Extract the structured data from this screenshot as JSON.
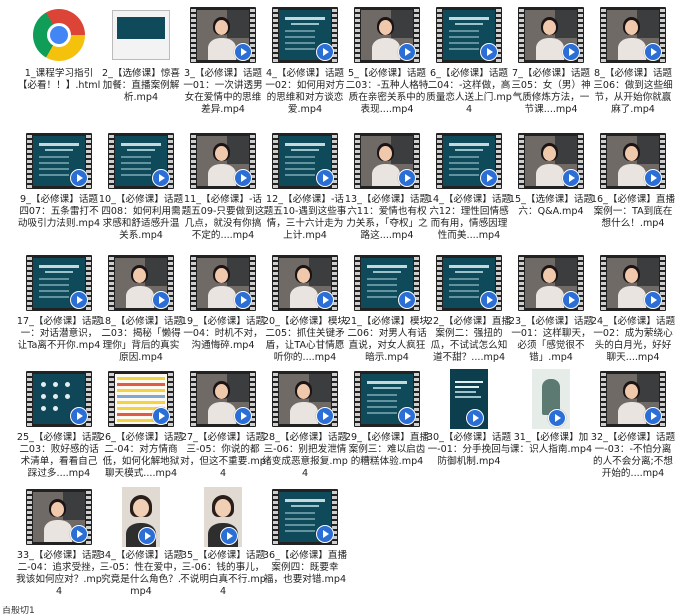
{
  "files": [
    {
      "name": "1_课程学习指引【必看！！】.html",
      "thumb": "chrome",
      "icon": "chrome-icon"
    },
    {
      "name": "2_【选修课】惊喜加餐：直播案例解析.mp4",
      "thumb": "webdoc",
      "icon": "document-icon"
    },
    {
      "name": "3_【必修课】话题一01：一次讲透男女在爱情中的思维差异.mp4",
      "thumb": "person",
      "icon": "video-icon"
    },
    {
      "name": "4_【必修课】话题一02：如何用对方的思维和对方谈恋爱.mp4",
      "thumb": "slide",
      "icon": "video-icon"
    },
    {
      "name": "5_【必修课】话题二03：-五种人格特质在亲密关系中的表现....mp4",
      "thumb": "person",
      "icon": "video-icon"
    },
    {
      "name": "6_【必修课】话题二04：-这样做，高质量恋人送上门.mp4",
      "thumb": "slide",
      "icon": "video-icon"
    },
    {
      "name": "7_【必修课】话题三05：女（男）神气质修炼方法，一节课....mp4",
      "thumb": "person",
      "icon": "video-icon"
    },
    {
      "name": "8_【必修课】话题三06：做到这些细节，从开始你就赢麻了.mp4",
      "thumb": "person",
      "icon": "video-icon"
    },
    {
      "name": "9_【必修课】话题四07：五条雷打不动吸引力法则.mp4",
      "thumb": "slide",
      "icon": "video-icon"
    },
    {
      "name": "10_【必修课】话题四08：如何利用需求感和舒适感升温关系.mp4",
      "thumb": "slide",
      "icon": "video-icon"
    },
    {
      "name": "11_【必修课】-话题五09-只要做到这几点，就没有你搞不定的....mp4",
      "thumb": "person",
      "icon": "video-icon"
    },
    {
      "name": "12_【必修课】-话题五10-遇到这些事情，三十六计走为上计.mp4",
      "thumb": "slide",
      "icon": "video-icon"
    },
    {
      "name": "13_【必修课】话题六11：爱情也有权力关系，「夺权」之路这....mp4",
      "thumb": "person",
      "icon": "video-icon"
    },
    {
      "name": "14_【必修课】话题六12：理性回情感而有用，情感因理性而美....mp4",
      "thumb": "slide",
      "icon": "video-icon"
    },
    {
      "name": "15_【选修课】话题六：Q&A.mp4",
      "thumb": "person",
      "icon": "video-icon"
    },
    {
      "name": "16_【必修课】直播案例一：TA到底在想什么！.mp4",
      "thumb": "person",
      "icon": "video-icon"
    },
    {
      "name": "17_【必修课】话题一：对话潜意识，让Ta离不开你.mp4",
      "thumb": "slide",
      "icon": "video-icon"
    },
    {
      "name": "18_【必修课】话题二03：揭秘「懒得理你」背后的真实原因.mp4",
      "thumb": "person",
      "icon": "video-icon"
    },
    {
      "name": "19_【必修课】话题一04：时机不对，沟通悔碎.mp4",
      "thumb": "person",
      "icon": "video-icon"
    },
    {
      "name": "20_【必修课】模块二05：抓住关键矛盾，让TA心甘情愿听你的....mp4",
      "thumb": "person",
      "icon": "video-icon"
    },
    {
      "name": "21_【必修课】模块二06：对男人有话直说，对女人疯狂暗示.mp4",
      "thumb": "slide",
      "icon": "video-icon"
    },
    {
      "name": "22_【必修课】直播案例二：强扭的瓜，不试试怎么知道不甜？....mp4",
      "thumb": "slide",
      "icon": "video-icon"
    },
    {
      "name": "23_【必修课】话题一01：这样聊天，必须「感觉很不错」.mp4",
      "thumb": "person",
      "icon": "video-icon"
    },
    {
      "name": "24_【必修课】话题一02：成为萦绕心头的白月光，好好聊天....mp4",
      "thumb": "person",
      "icon": "video-icon"
    },
    {
      "name": "25_【必修课】话题二03：败好感的话术清单，看看自己踩过多....mp4",
      "thumb": "dots",
      "icon": "video-icon"
    },
    {
      "name": "26_【必修课】话题二-04：对方情商低，如何化解地狱聊天模式....mp4",
      "thumb": "sheet",
      "icon": "video-icon"
    },
    {
      "name": "27_【必修课】话题三-05：你说的都对，但这不重要.mp4",
      "thumb": "person",
      "icon": "video-icon"
    },
    {
      "name": "28_【必修课】话题三-06：别把发泄情绪变成恶意报复.mp4",
      "thumb": "person",
      "icon": "video-icon"
    },
    {
      "name": "29_【必修课】直播案例三：难以启齿的糟糕体验.mp4",
      "thumb": "slide",
      "icon": "video-icon"
    },
    {
      "name": "30_【必修课】话题一-01：分手挽回与防御机制.mp4",
      "thumb": "portrait",
      "icon": "video-icon"
    },
    {
      "name": "31_【必修课】加课：识人指南.mp4",
      "thumb": "phone",
      "icon": "video-icon"
    },
    {
      "name": "32_【必修课】话题一-03：-不怕分离的人不会分离;不想开始的....mp4",
      "thumb": "person",
      "icon": "video-icon"
    },
    {
      "name": "33_【必修课】话题二-04：追求受挫，我该如何应对？.mp4",
      "thumb": "person",
      "icon": "video-icon"
    },
    {
      "name": "34_【必修课】话题三-05：性在爱中，究竟是什么角色？.mp4",
      "thumb": "person-portrait",
      "icon": "video-icon"
    },
    {
      "name": "35_【必修课】话题三-06：钱的事儿，不说明白真不行.mp4",
      "thumb": "person-portrait",
      "icon": "video-icon"
    },
    {
      "name": "36_【必修课】直播案例四：既要幸福，也要对错.mp4",
      "thumb": "slide",
      "icon": "video-icon"
    }
  ],
  "footer_text": "百般切1"
}
